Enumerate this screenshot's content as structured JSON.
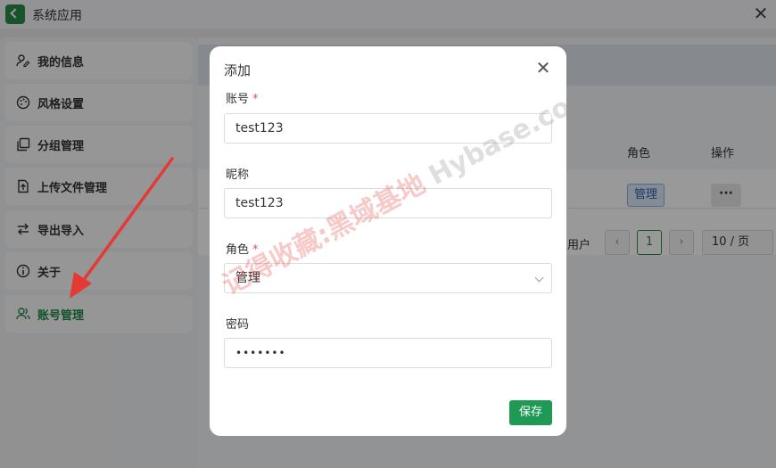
{
  "window": {
    "title": "系统应用",
    "close_symbol": "✕"
  },
  "sidebar": {
    "items": [
      {
        "label": "我的信息",
        "icon": "user-edit-icon",
        "active": false
      },
      {
        "label": "风格设置",
        "icon": "palette-icon",
        "active": false
      },
      {
        "label": "分组管理",
        "icon": "copy-icon",
        "active": false
      },
      {
        "label": "上传文件管理",
        "icon": "upload-file-icon",
        "active": false
      },
      {
        "label": "导出导入",
        "icon": "import-export-icon",
        "active": false
      },
      {
        "label": "关于",
        "icon": "info-icon",
        "active": false
      },
      {
        "label": "账号管理",
        "icon": "users-icon",
        "active": true
      }
    ]
  },
  "table": {
    "columns": {
      "role": "角色",
      "operation": "操作"
    },
    "rows": [
      {
        "role": "管理",
        "more": "···"
      }
    ]
  },
  "pagination": {
    "suffix_text": "用户",
    "prev": "‹",
    "current_page": "1",
    "next": "›",
    "page_size": "10 / 页"
  },
  "modal": {
    "title": "添加",
    "close_symbol": "✕",
    "fields": {
      "account": {
        "label": "账号",
        "required": "*",
        "value": "test123"
      },
      "nickname": {
        "label": "昵称",
        "value": "test123"
      },
      "role": {
        "label": "角色",
        "required": "*",
        "value": "管理"
      },
      "password": {
        "label": "密码",
        "value": "•••••••"
      }
    },
    "save_label": "保存"
  },
  "watermark": {
    "cn": "记得收藏:黑域基地",
    "en": "Hybase.com"
  },
  "colors": {
    "accent": "#1f9a55",
    "required": "#d9534f",
    "annotation_arrow": "#e53935"
  }
}
